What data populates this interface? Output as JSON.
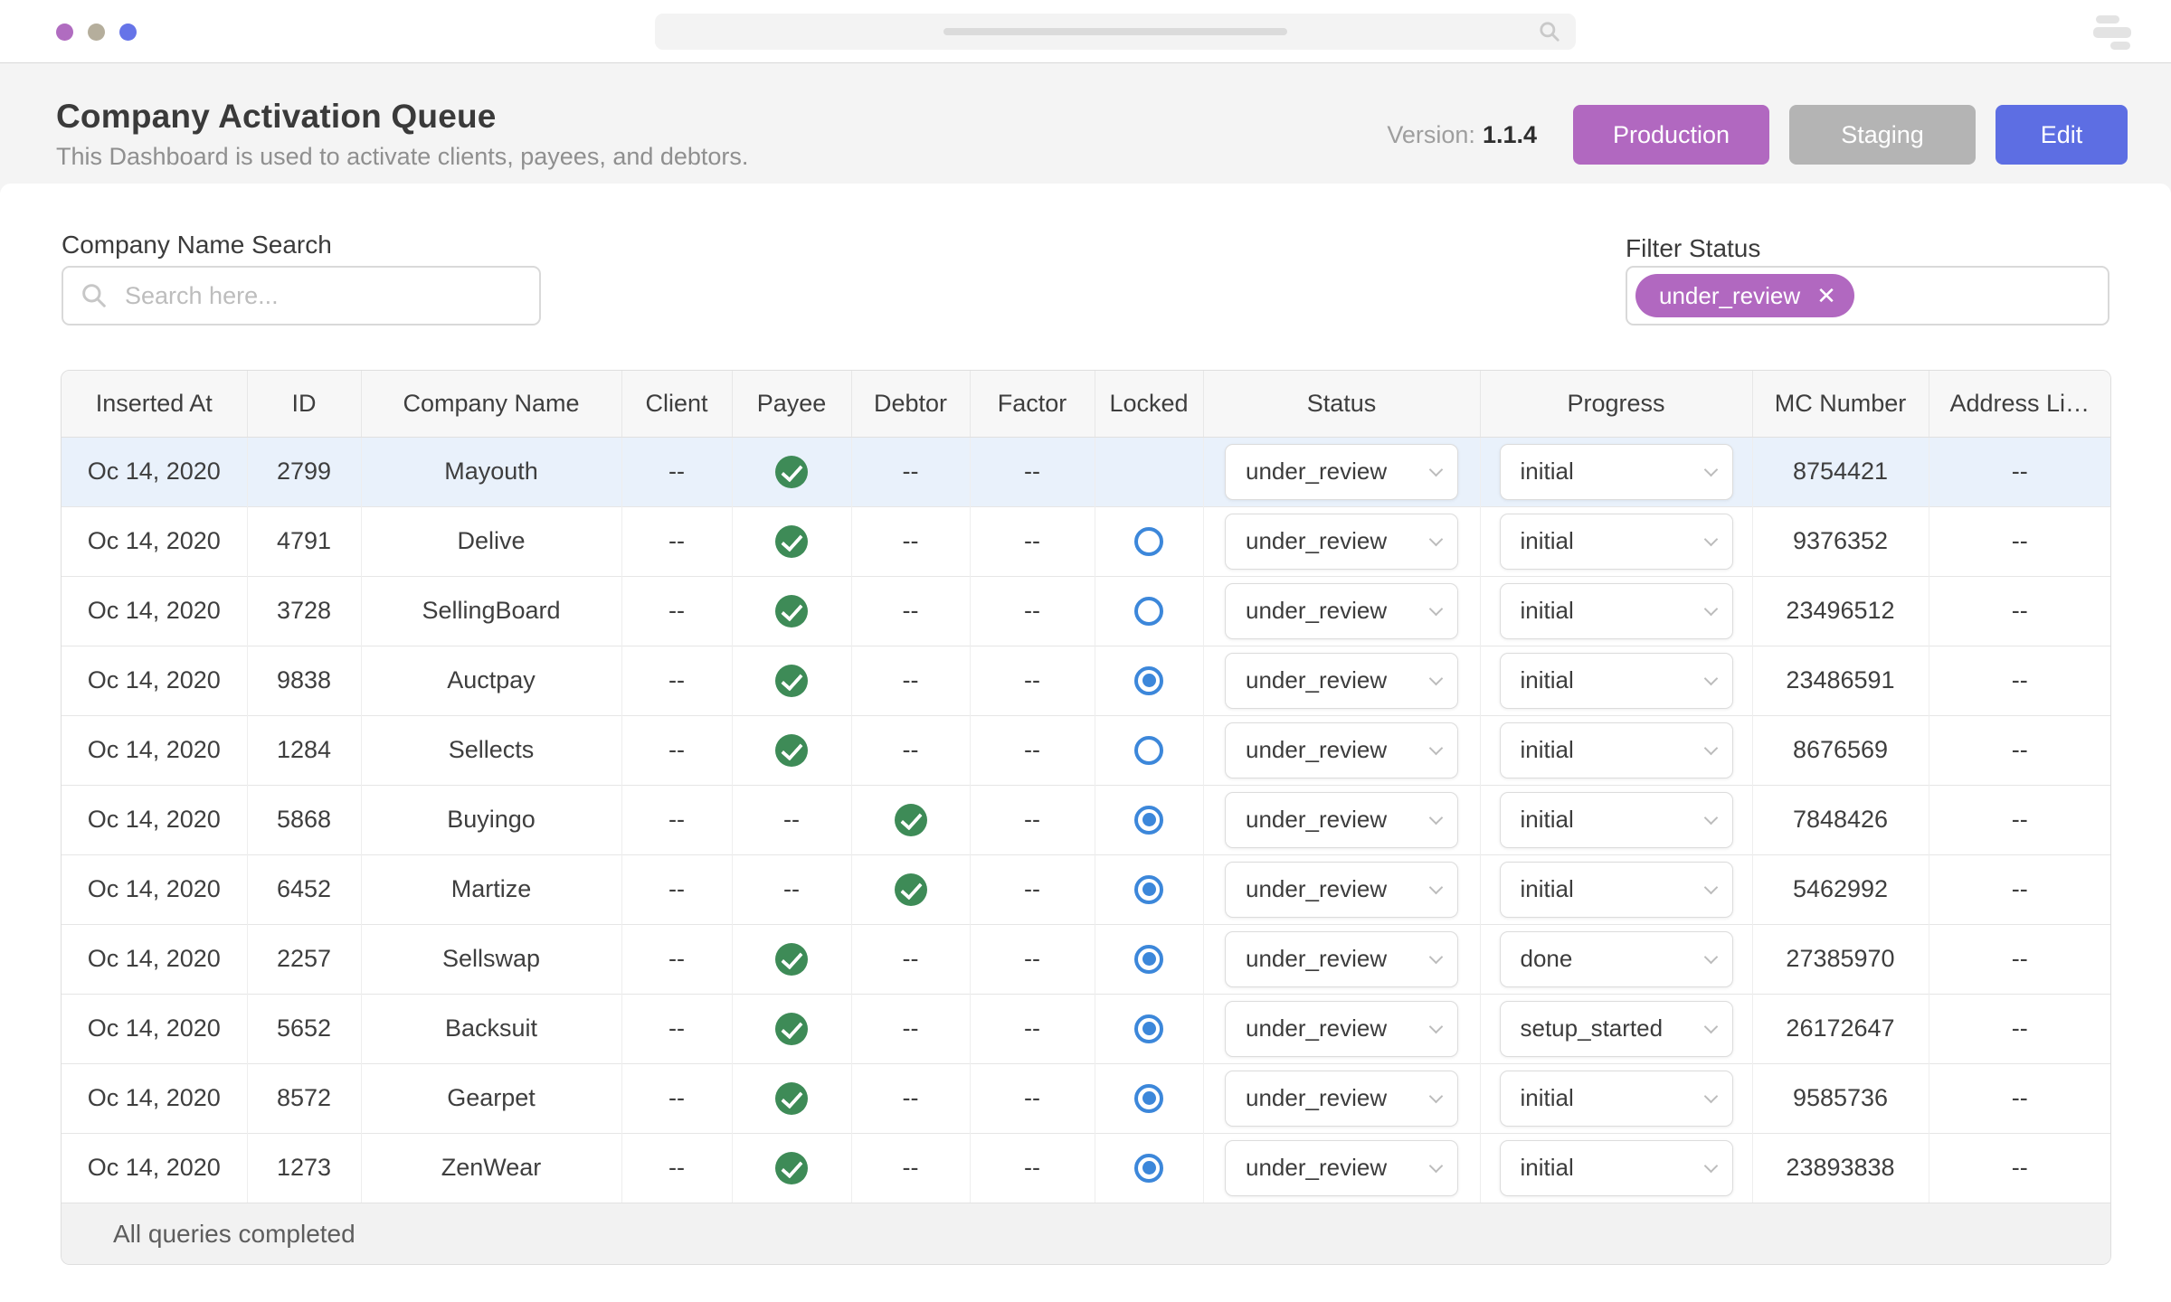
{
  "colors": {
    "purple": "#b168c0",
    "gray_button": "#b4b4b4",
    "blue_button": "#5d6ee3",
    "check_green": "#3e8b57",
    "radio_blue": "#3c87da",
    "row_highlight": "#e9f1fb"
  },
  "chrome": {
    "dot_colors": [
      "#b06cc0",
      "#b5ae9c",
      "#6674e8"
    ]
  },
  "header": {
    "title": "Company Activation Queue",
    "subtitle": "This Dashboard is used to activate clients, payees, and debtors.",
    "version_label": "Version:",
    "version_value": "1.1.4",
    "buttons": [
      {
        "label": "Production"
      },
      {
        "label": "Staging"
      },
      {
        "label": "Edit"
      }
    ]
  },
  "filters": {
    "search_label": "Company Name Search",
    "search_placeholder": "Search here...",
    "filter_label": "Filter Status",
    "chip_label": "under_review",
    "chip_close_icon": "✕"
  },
  "table": {
    "columns": [
      "Inserted At",
      "ID",
      "Company Name",
      "Client",
      "Payee",
      "Debtor",
      "Factor",
      "Locked",
      "Status",
      "Progress",
      "MC Number",
      "Address Li…"
    ],
    "footer": "All queries completed",
    "rows": [
      {
        "inserted_at": "Oc 14, 2020",
        "id": "2799",
        "company": "Mayouth",
        "client": "--",
        "payee": "check",
        "debtor": "--",
        "factor": "--",
        "locked": "none",
        "status": "under_review",
        "progress": "initial",
        "mc": "8754421",
        "address": "--",
        "highlight": true
      },
      {
        "inserted_at": "Oc 14, 2020",
        "id": "4791",
        "company": "Delive",
        "client": "--",
        "payee": "check",
        "debtor": "--",
        "factor": "--",
        "locked": "unchecked",
        "status": "under_review",
        "progress": "initial",
        "mc": "9376352",
        "address": "--"
      },
      {
        "inserted_at": "Oc 14, 2020",
        "id": "3728",
        "company": "SellingBoard",
        "client": "--",
        "payee": "check",
        "debtor": "--",
        "factor": "--",
        "locked": "unchecked",
        "status": "under_review",
        "progress": "initial",
        "mc": "23496512",
        "address": "--"
      },
      {
        "inserted_at": "Oc 14, 2020",
        "id": "9838",
        "company": "Auctpay",
        "client": "--",
        "payee": "check",
        "debtor": "--",
        "factor": "--",
        "locked": "checked",
        "status": "under_review",
        "progress": "initial",
        "mc": "23486591",
        "address": "--"
      },
      {
        "inserted_at": "Oc 14, 2020",
        "id": "1284",
        "company": "Sellects",
        "client": "--",
        "payee": "check",
        "debtor": "--",
        "factor": "--",
        "locked": "unchecked",
        "status": "under_review",
        "progress": "initial",
        "mc": "8676569",
        "address": "--"
      },
      {
        "inserted_at": "Oc 14, 2020",
        "id": "5868",
        "company": "Buyingo",
        "client": "--",
        "payee": "--",
        "debtor": "check",
        "factor": "--",
        "locked": "checked",
        "status": "under_review",
        "progress": "initial",
        "mc": "7848426",
        "address": "--"
      },
      {
        "inserted_at": "Oc 14, 2020",
        "id": "6452",
        "company": "Martize",
        "client": "--",
        "payee": "--",
        "debtor": "check",
        "factor": "--",
        "locked": "checked",
        "status": "under_review",
        "progress": "initial",
        "mc": "5462992",
        "address": "--"
      },
      {
        "inserted_at": "Oc 14, 2020",
        "id": "2257",
        "company": "Sellswap",
        "client": "--",
        "payee": "check",
        "debtor": "--",
        "factor": "--",
        "locked": "checked",
        "status": "under_review",
        "progress": "done",
        "mc": "27385970",
        "address": "--"
      },
      {
        "inserted_at": "Oc 14, 2020",
        "id": "5652",
        "company": "Backsuit",
        "client": "--",
        "payee": "check",
        "debtor": "--",
        "factor": "--",
        "locked": "checked",
        "status": "under_review",
        "progress": "setup_started",
        "mc": "26172647",
        "address": "--"
      },
      {
        "inserted_at": "Oc 14, 2020",
        "id": "8572",
        "company": "Gearpet",
        "client": "--",
        "payee": "check",
        "debtor": "--",
        "factor": "--",
        "locked": "checked",
        "status": "under_review",
        "progress": "initial",
        "mc": "9585736",
        "address": "--"
      },
      {
        "inserted_at": "Oc 14, 2020",
        "id": "1273",
        "company": "ZenWear",
        "client": "--",
        "payee": "check",
        "debtor": "--",
        "factor": "--",
        "locked": "checked",
        "status": "under_review",
        "progress": "initial",
        "mc": "23893838",
        "address": "--"
      }
    ]
  }
}
